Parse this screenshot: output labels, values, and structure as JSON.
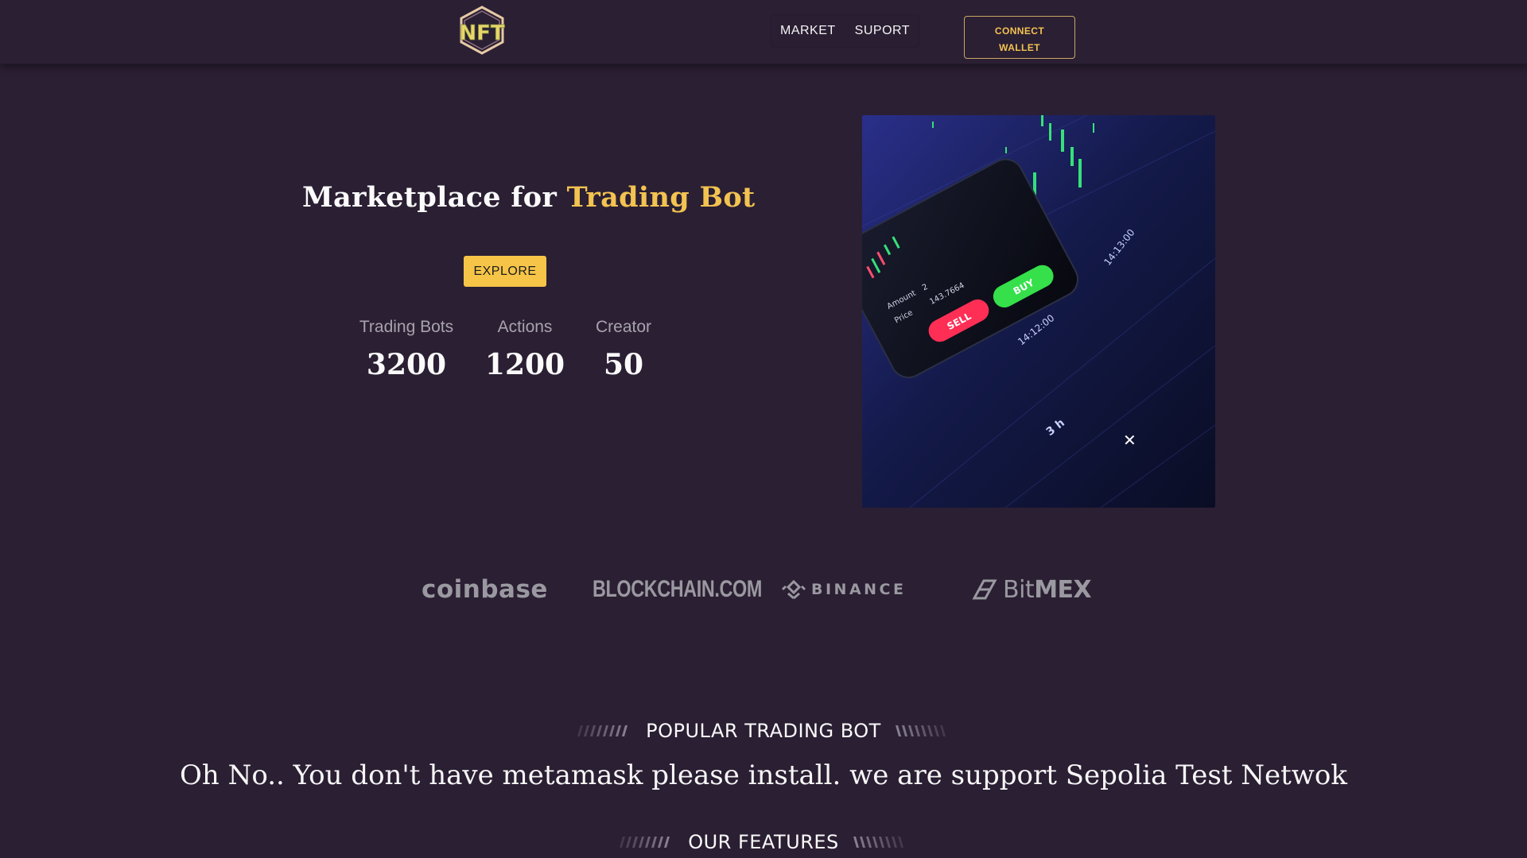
{
  "header": {
    "logo_text": "NFT",
    "nav": [
      {
        "label": "MARKET"
      },
      {
        "label": "SUPORT"
      }
    ],
    "connect_line1": "CONNECT",
    "connect_line2": "WALLET"
  },
  "hero": {
    "title_prefix": "Marketplace for",
    "title_accent": "Trading Bot",
    "explore_label": "EXPLORE",
    "stats": [
      {
        "label": "Trading Bots",
        "value": "3200"
      },
      {
        "label": "Actions",
        "value": "1200"
      },
      {
        "label": "Creator",
        "value": "50"
      }
    ],
    "image_texts": {
      "sell": "SELL",
      "buy": "BUY",
      "amount_label": "Amount",
      "amount_value": "2",
      "price_label": "Price",
      "price_value": "143.7664",
      "time_1": "14:13:00",
      "time_2": "14:12:00",
      "interval": "3 h"
    }
  },
  "partners": [
    {
      "name": "coinbase"
    },
    {
      "name": "BLOCKCHAIN.COM"
    },
    {
      "name": "BINANCE"
    },
    {
      "name_regular": "Bit",
      "name_bold": "MEX"
    }
  ],
  "sections": {
    "popular_title": "POPULAR TRADING BOT",
    "notice": "Oh No.. You don't have metamask please install. we are support Sepolia Test Netwok",
    "features_title": "OUR FEATURES"
  },
  "colors": {
    "background": "#2b1f33",
    "accent": "#f3c351",
    "button": "#f6c548",
    "muted": "#a7a3ad"
  },
  "icons": {
    "logo": "nft-hexagon-logo",
    "binance": "binance-diamond-icon",
    "bitmex": "bitmex-slash-icon"
  }
}
